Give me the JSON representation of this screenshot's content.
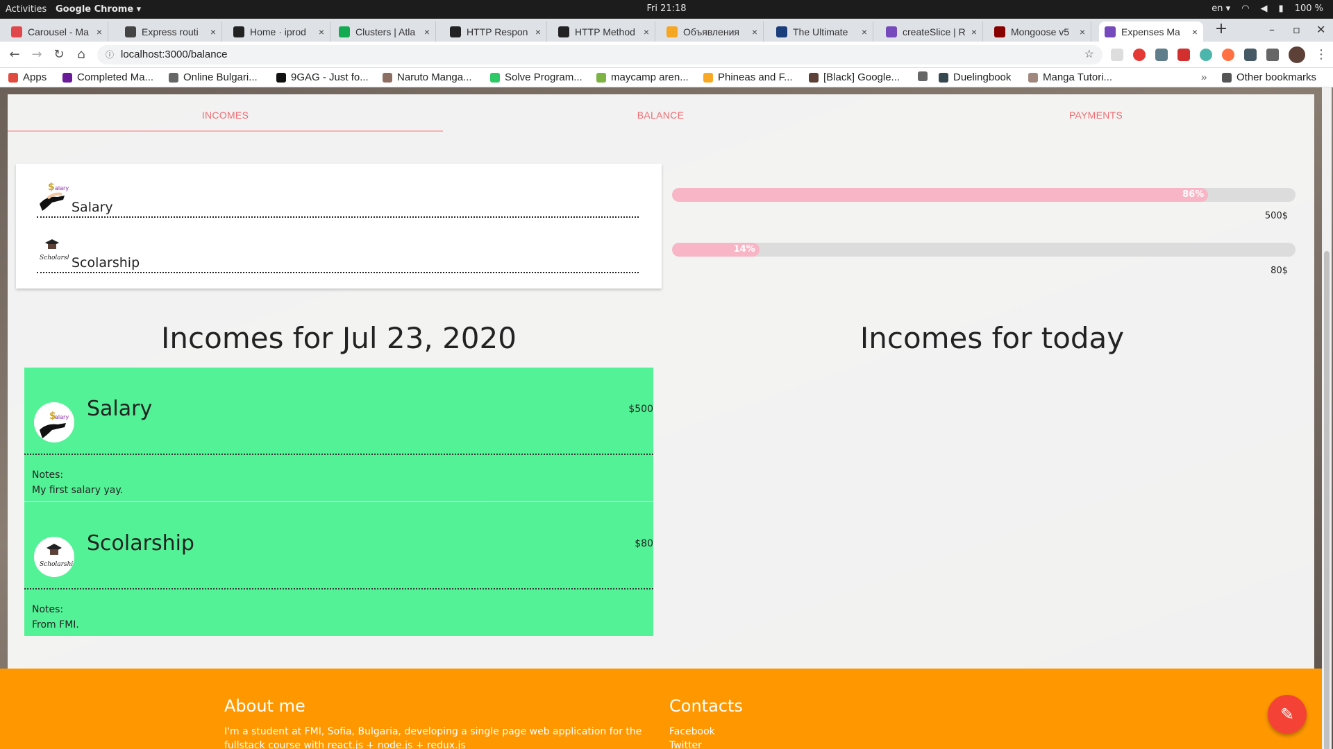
{
  "os_bar": {
    "activities": "Activities",
    "app_name": "Google Chrome ▾",
    "clock": "Fri 21:18",
    "lang": "en ▾",
    "battery": "100 %"
  },
  "tabs": [
    {
      "title": "Carousel - Ma",
      "icon_color": "#e0474c"
    },
    {
      "title": "Express routi",
      "icon_color": "#444444"
    },
    {
      "title": "Home · iprod",
      "icon_color": "#222222"
    },
    {
      "title": "Clusters | Atla",
      "icon_color": "#13aa52"
    },
    {
      "title": "HTTP Respon",
      "icon_color": "#222222"
    },
    {
      "title": "HTTP Method",
      "icon_color": "#222222"
    },
    {
      "title": "Объявления",
      "icon_color": "#f5a623"
    },
    {
      "title": "The Ultimate",
      "icon_color": "#1a3d7c"
    },
    {
      "title": "createSlice | R",
      "icon_color": "#764abc"
    },
    {
      "title": "Mongoose v5",
      "icon_color": "#880000"
    },
    {
      "title": "Expenses Ma",
      "icon_color": "#764abc"
    }
  ],
  "active_tab_index": 10,
  "address": "localhost:3000/balance",
  "bookmarks": [
    {
      "label": "Apps",
      "icon_color": "#e04a3f"
    },
    {
      "label": "Completed Ma...",
      "icon_color": "#6a1b9a"
    },
    {
      "label": "Online Bulgari...",
      "icon_color": "#666666"
    },
    {
      "label": "9GAG - Just fo...",
      "icon_color": "#111111"
    },
    {
      "label": "Naruto Manga...",
      "icon_color": "#8d6e63"
    },
    {
      "label": "Solve Program...",
      "icon_color": "#2ec866"
    },
    {
      "label": "maycamp aren...",
      "icon_color": "#7cb342"
    },
    {
      "label": "Phineas and F...",
      "icon_color": "#f9a825"
    },
    {
      "label": "[Black] Google...",
      "icon_color": "#5d4037"
    },
    {
      "label": "",
      "icon_color": "#666666"
    },
    {
      "label": "Duelingbook",
      "icon_color": "#37474f"
    },
    {
      "label": "Manga Tutori...",
      "icon_color": "#a1887f"
    }
  ],
  "other_bookmarks": "Other bookmarks",
  "nav": {
    "tabs": [
      "INCOMES",
      "BALANCE",
      "PAYMENTS"
    ],
    "active": 0
  },
  "categories": [
    {
      "label": "Salary",
      "icon": "salary-icon",
      "percent": 86,
      "percent_label": "86%",
      "amount": "500$"
    },
    {
      "label": "Scolarship",
      "icon": "scholarship-icon",
      "percent": 14,
      "percent_label": "14%",
      "amount": "80$"
    }
  ],
  "headings": {
    "left": "Incomes for Jul 23, 2020",
    "right": "Incomes for today"
  },
  "entries": [
    {
      "title": "Salary",
      "amount": "$500",
      "notes_label": "Notes:",
      "notes": "My first salary yay.",
      "icon": "salary-icon"
    },
    {
      "title": "Scolarship",
      "amount": "$80",
      "notes_label": "Notes:",
      "notes": "From FMI.",
      "icon": "scholarship-icon"
    }
  ],
  "footer": {
    "about_title": "About me",
    "about_text": "I'm a student at FMI, Sofia, Bulgaria, developing a single page web application for the fullstack course with react.js + node.js + redux.js",
    "contacts_title": "Contacts",
    "contacts": [
      "Facebook",
      "Twitter"
    ]
  },
  "colors": {
    "accent": "#ee6e73",
    "entry_bg": "#54f296",
    "footer_bg": "#ff9800",
    "fab_bg": "#f44336",
    "bar_fill": "#f8b5c5"
  },
  "fab_icon": "edit-icon"
}
